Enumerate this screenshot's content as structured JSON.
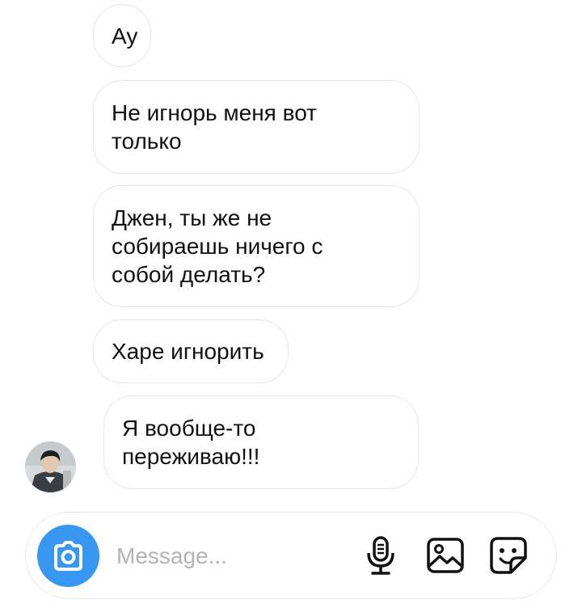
{
  "messages": [
    {
      "text": "Ау"
    },
    {
      "text": "Не игнорь меня вот\nтолько"
    },
    {
      "text": "Джен, ты же не\nсобираешь ничего с\nсобой делать?"
    },
    {
      "text": "Харе игнорить"
    },
    {
      "text": "Я вообще-то\nпереживаю!!!"
    }
  ],
  "composer": {
    "placeholder": "Message..."
  },
  "icons": {
    "camera": "camera-icon",
    "mic": "microphone-icon",
    "gallery": "image-gallery-icon",
    "sticker": "sticker-icon"
  },
  "colors": {
    "accent": "#3897f0",
    "bubble_border": "#e6e6e6",
    "text": "#111111",
    "placeholder": "#b3b3b3"
  }
}
